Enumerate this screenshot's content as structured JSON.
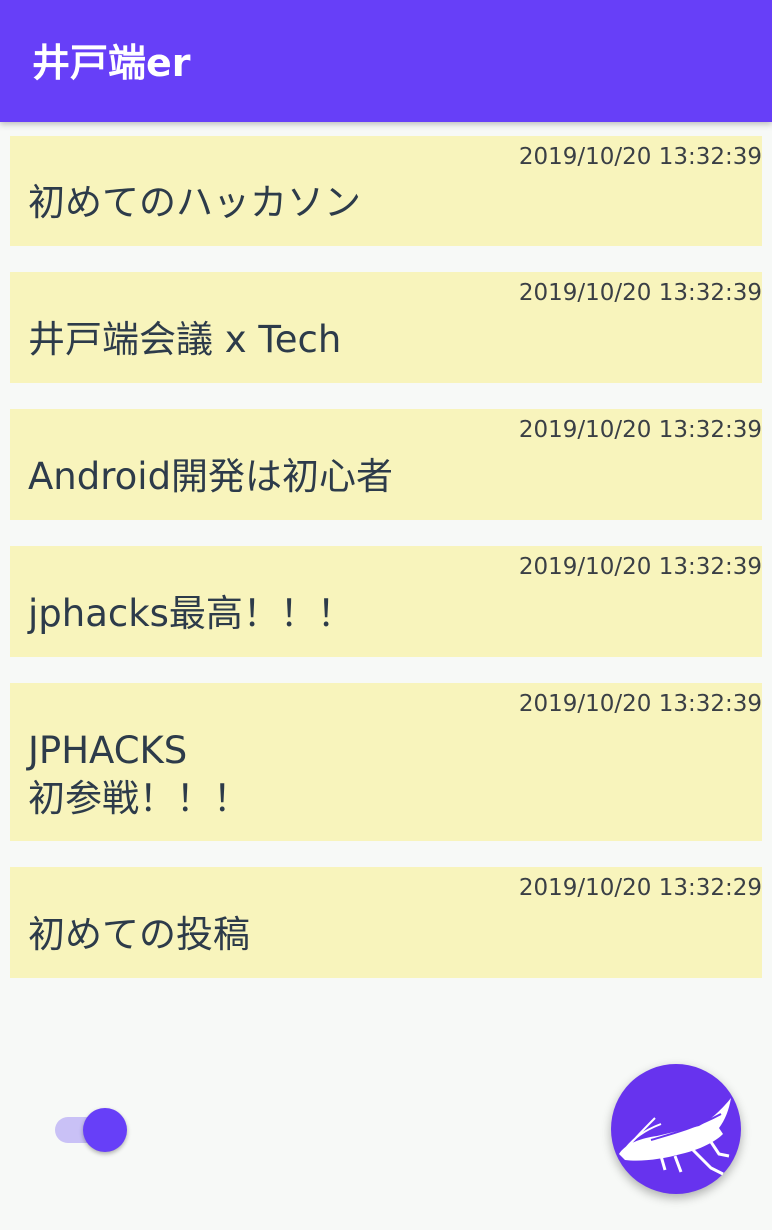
{
  "app": {
    "title": "井戸端er",
    "accent_color": "#673ff8"
  },
  "posts": [
    {
      "timestamp": "2019/10/20 13:32:39",
      "text": "初めてのハッカソン"
    },
    {
      "timestamp": "2019/10/20 13:32:39",
      "text": "井戸端会議 x Tech"
    },
    {
      "timestamp": "2019/10/20 13:32:39",
      "text": "Android開発は初心者"
    },
    {
      "timestamp": "2019/10/20 13:32:39",
      "text": "jphacks最高！！！"
    },
    {
      "timestamp": "2019/10/20 13:32:39",
      "text": "JPHACKS\n初参戦！！！"
    },
    {
      "timestamp": "2019/10/20 13:32:29",
      "text": "初めての投稿"
    }
  ],
  "controls": {
    "toggle_state": "on",
    "fab_icon": "grasshopper-icon"
  }
}
